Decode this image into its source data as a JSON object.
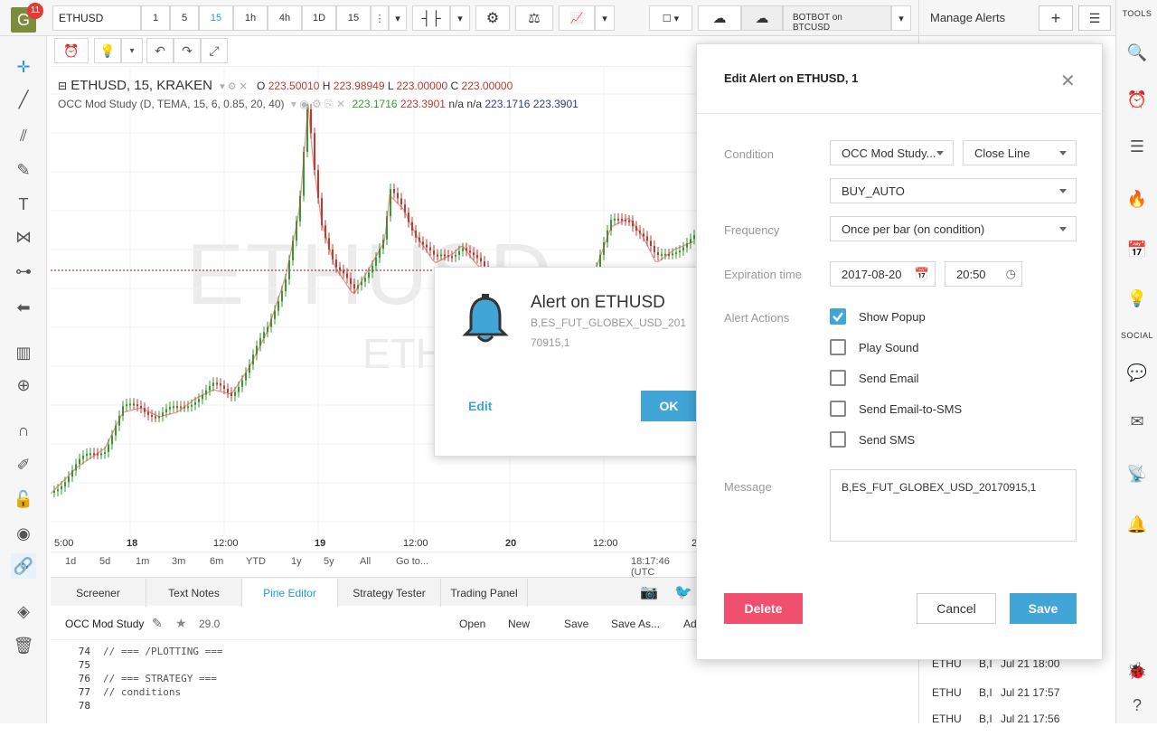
{
  "topbar": {
    "avatar_letter": "G",
    "notification_count": "11",
    "symbol": "ETHUSD",
    "intervals": [
      "1",
      "5",
      "15",
      "1h",
      "4h",
      "1D",
      "15"
    ],
    "active_interval": "15",
    "broker_label": "BOTBOT on BTCUSD"
  },
  "chart": {
    "watermark_symbol": "ETHUSD",
    "watermark_sub": "ETH",
    "legend_symbol": "ETHUSD, 15, KRAKEN",
    "ohlc": {
      "o_label": "O",
      "o": "223.50010",
      "h_label": "H",
      "h": "223.98949",
      "l_label": "L",
      "l": "223.00000",
      "c_label": "C",
      "c": "223.00000"
    },
    "study_label": "OCC Mod Study (D, TEMA, 15, 6, 0.85, 20, 40)",
    "study_values": [
      "223.1716",
      "223.3901",
      "n/a",
      "n/a",
      "223.1716",
      "223.3901"
    ],
    "time_labels": [
      "5:00",
      "18",
      "12:00",
      "19",
      "12:00",
      "20",
      "12:00",
      "2"
    ],
    "clock": "18:17:46 (UTC",
    "ranges": [
      "1d",
      "5d",
      "1m",
      "3m",
      "6m",
      "YTD",
      "1y",
      "5y",
      "All",
      "Go to..."
    ],
    "colors": {
      "up": "#2e9e2e",
      "down": "#c0392b",
      "ma": "#d94040"
    }
  },
  "bottom": {
    "tabs": [
      "Screener",
      "Text Notes",
      "Pine Editor",
      "Strategy Tester",
      "Trading Panel"
    ],
    "active_tab": "Pine Editor",
    "script_name": "OCC Mod Study",
    "version": "29.0",
    "actions": [
      "Open",
      "New",
      "Save",
      "Save As...",
      "Ad"
    ],
    "code_lines": [
      {
        "n": "74",
        "t": "// === /PLOTTING ==="
      },
      {
        "n": "75",
        "t": ""
      },
      {
        "n": "76",
        "t": "// === STRATEGY ==="
      },
      {
        "n": "77",
        "t": "// conditions"
      },
      {
        "n": "78",
        "t": ""
      }
    ]
  },
  "rightpanel": {
    "title": "Manage Alerts",
    "rows": [
      {
        "symbol": "ETHU",
        "desc": "B,I",
        "time": "Jul 21 18:00"
      },
      {
        "symbol": "ETHU",
        "desc": "B,I",
        "time": "Jul 21 17:57"
      },
      {
        "symbol": "ETHU",
        "desc": "B,I",
        "time": "Jul 21 17:56"
      }
    ]
  },
  "farright": {
    "tools_label": "TOOLS",
    "social_label": "SOCIAL"
  },
  "popup": {
    "title": "Alert on ETHUSD",
    "message_line1": "B,ES_FUT_GLOBEX_USD_201",
    "message_line2": "70915,1",
    "edit_label": "Edit",
    "ok_label": "OK"
  },
  "dialog": {
    "title": "Edit Alert on ETHUSD, 1",
    "condition_label": "Condition",
    "condition_study": "OCC Mod Study...",
    "condition_line": "Close Line",
    "condition_value": "BUY_AUTO",
    "frequency_label": "Frequency",
    "frequency_value": "Once per bar (on condition)",
    "expiration_label": "Expiration time",
    "expiration_date": "2017-08-20",
    "expiration_time": "20:50",
    "actions_label": "Alert Actions",
    "actions": [
      {
        "label": "Show Popup",
        "checked": true
      },
      {
        "label": "Play Sound",
        "checked": false
      },
      {
        "label": "Send Email",
        "checked": false
      },
      {
        "label": "Send Email-to-SMS",
        "checked": false
      },
      {
        "label": "Send SMS",
        "checked": false
      }
    ],
    "message_label": "Message",
    "message_value": "B,ES_FUT_GLOBEX_USD_20170915,1",
    "delete_label": "Delete",
    "cancel_label": "Cancel",
    "save_label": "Save",
    "accent": "#42a5d8",
    "danger": "#f0506e"
  }
}
